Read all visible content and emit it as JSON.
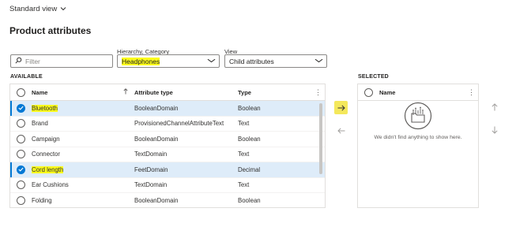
{
  "header": {
    "view_label": "Standard view",
    "title": "Product attributes"
  },
  "filters": {
    "filter_placeholder": "Filter",
    "hierarchy_label": "Hierarchy, Category",
    "hierarchy_value": "Headphones",
    "view_label": "View",
    "view_value": "Child attributes"
  },
  "available": {
    "section_label": "AVAILABLE",
    "columns": {
      "name": "Name",
      "type": "Attribute type",
      "datatype": "Type"
    },
    "rows": [
      {
        "name": "Bluetooth",
        "type": "BooleanDomain",
        "datatype": "Boolean",
        "selected": true,
        "highlight": true
      },
      {
        "name": "Brand",
        "type": "ProvisionedChannelAttributeText",
        "datatype": "Text",
        "selected": false,
        "highlight": false
      },
      {
        "name": "Campaign",
        "type": "BooleanDomain",
        "datatype": "Boolean",
        "selected": false,
        "highlight": false
      },
      {
        "name": "Connector",
        "type": "TextDomain",
        "datatype": "Text",
        "selected": false,
        "highlight": false
      },
      {
        "name": "Cord length",
        "type": "FeetDomain",
        "datatype": "Decimal",
        "selected": true,
        "highlight": true
      },
      {
        "name": "Ear Cushions",
        "type": "TextDomain",
        "datatype": "Text",
        "selected": false,
        "highlight": false
      },
      {
        "name": "Folding",
        "type": "BooleanDomain",
        "datatype": "Boolean",
        "selected": false,
        "highlight": false
      }
    ]
  },
  "selected": {
    "section_label": "SELECTED",
    "column_name": "Name",
    "empty_text": "We didn't find anything to show here."
  },
  "icons": {
    "view_chevron": "chevron-down-icon",
    "search": "search-icon",
    "add": "arrow-right-icon",
    "remove": "arrow-left-icon",
    "move_up": "arrow-up-icon",
    "move_down": "arrow-down-icon",
    "empty_state": "empty-folder-icon"
  },
  "colors": {
    "accent": "#0078d4",
    "selected_row": "#deecf9",
    "highlight": "#fbfb1c"
  }
}
